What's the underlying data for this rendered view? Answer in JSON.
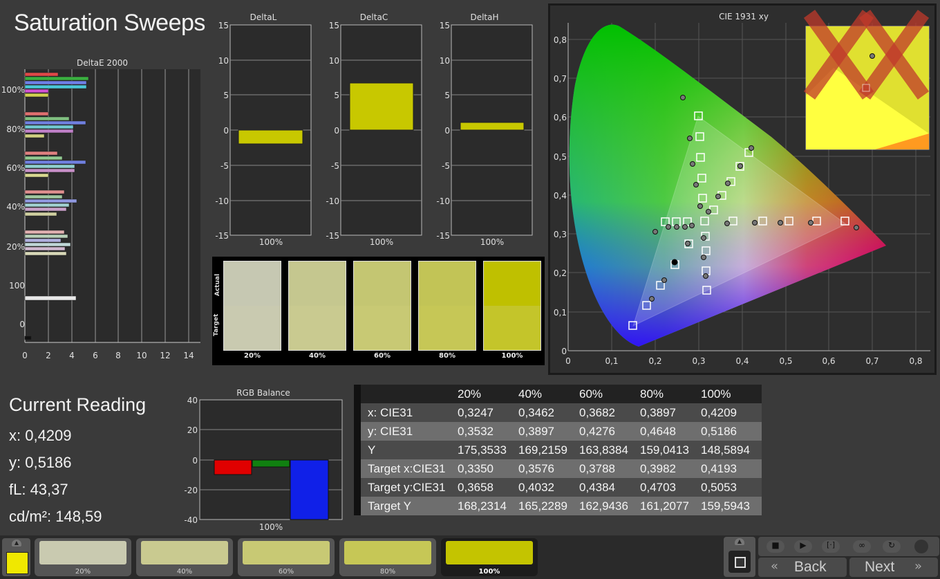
{
  "title": "Saturation Sweeps",
  "deltaE": {
    "title": "DeltaE 2000",
    "y_labels": [
      "100%",
      "80%",
      "60%",
      "40%",
      "20%",
      "100",
      "0"
    ],
    "x_labels": [
      "0",
      "2",
      "4",
      "6",
      "8",
      "10",
      "12",
      "14"
    ]
  },
  "deltaL": {
    "title": "DeltaL",
    "value": -2,
    "xlabel": "100%"
  },
  "deltaC": {
    "title": "DeltaC",
    "value": 6.7,
    "xlabel": "100%"
  },
  "deltaH": {
    "title": "DeltaH",
    "value": 1,
    "xlabel": "100%"
  },
  "delta_ticks": [
    "15",
    "10",
    "5",
    "0",
    "-5",
    "-10",
    "-15"
  ],
  "patches": {
    "actual_label": "Actual",
    "target_label": "Target",
    "items": [
      {
        "label": "20%",
        "actual": "#c6c8b2",
        "target": "#c9cab0"
      },
      {
        "label": "40%",
        "actual": "#c5c78f",
        "target": "#c9ca90"
      },
      {
        "label": "60%",
        "actual": "#c4c672",
        "target": "#c8c974"
      },
      {
        "label": "80%",
        "actual": "#c2c456",
        "target": "#c6c756"
      },
      {
        "label": "100%",
        "actual": "#bfc000",
        "target": "#c4c52a"
      }
    ]
  },
  "cie": {
    "title": "CIE 1931 xy",
    "x_ticks": [
      "0",
      "0,1",
      "0,2",
      "0,3",
      "0,4",
      "0,5",
      "0,6",
      "0,7",
      "0,8"
    ],
    "y_ticks": [
      "0,8",
      "0,7",
      "0,6",
      "0,5",
      "0,4",
      "0,3",
      "0,2",
      "0,1",
      "0"
    ]
  },
  "current": {
    "title": "Current Reading",
    "x": "x: 0,4209",
    "y": "y: 0,5186",
    "fl": "fL: 43,37",
    "cdm": "cd/m²: 148,59"
  },
  "rgb": {
    "title": "RGB Balance",
    "ticks": [
      "40",
      "20",
      "0",
      "-20",
      "-40"
    ],
    "xlabel": "100%",
    "red": -10,
    "green": -5,
    "blue": -40
  },
  "table": {
    "headers": [
      "",
      "20%",
      "40%",
      "60%",
      "80%",
      "100%"
    ],
    "rows": [
      [
        "x: CIE31",
        "0,3247",
        "0,3462",
        "0,3682",
        "0,3897",
        "0,4209"
      ],
      [
        "y: CIE31",
        "0,3532",
        "0,3897",
        "0,4276",
        "0,4648",
        "0,5186"
      ],
      [
        "Y",
        "175,3533",
        "169,2159",
        "163,8384",
        "159,0413",
        "148,5894"
      ],
      [
        "Target x:CIE31",
        "0,3350",
        "0,3576",
        "0,3788",
        "0,3982",
        "0,4193"
      ],
      [
        "Target y:CIE31",
        "0,3658",
        "0,4032",
        "0,4384",
        "0,4703",
        "0,5053"
      ],
      [
        "Target Y",
        "168,2314",
        "165,2289",
        "162,9436",
        "161,2077",
        "159,5943"
      ]
    ]
  },
  "swatches": [
    {
      "label": "20%",
      "color": "#c9cab0"
    },
    {
      "label": "40%",
      "color": "#c9ca90"
    },
    {
      "label": "60%",
      "color": "#c8c974"
    },
    {
      "label": "80%",
      "color": "#c6c756"
    },
    {
      "label": "100%",
      "color": "#c4c400"
    }
  ],
  "nav": {
    "back": "Back",
    "next": "Next"
  }
}
